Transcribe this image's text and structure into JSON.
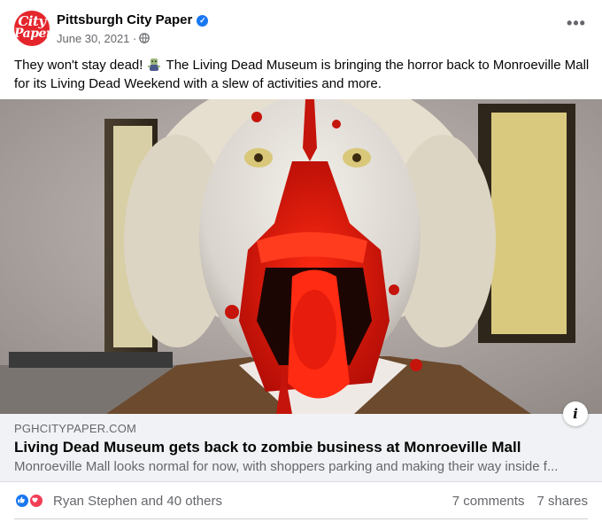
{
  "post": {
    "page_name": "Pittsburgh City Paper",
    "avatar_text_line1": "City",
    "avatar_text_line2": "Paper",
    "date": "June 30, 2021",
    "separator": "·",
    "more_label": "•••",
    "text_before_emoji": "They won't stay dead!",
    "text_after_emoji": "The Living Dead Museum is bringing the horror back to Monroeville Mall for its Living Dead Weekend with a slew of activities and more.",
    "icons": {
      "verified": "verified-badge-icon",
      "privacy": "globe-icon",
      "emoji": "zombie-emoji",
      "info": "info-icon",
      "like": "like-reaction-icon",
      "love": "love-reaction-icon"
    }
  },
  "link": {
    "domain": "PGHCITYPAPER.COM",
    "title": "Living Dead Museum gets back to zombie business at Monroeville Mall",
    "description": "Monroeville Mall looks normal for now, with shoppers parking and making their way inside f...",
    "info_label": "i"
  },
  "engagement": {
    "reaction_names": "Ryan Stephen and 40 others",
    "comments": "7 comments",
    "shares": "7 shares"
  },
  "colors": {
    "brand_red": "#e4262c",
    "facebook_blue": "#1877f2",
    "love_red": "#f33e58",
    "secondary_text": "#65676b"
  }
}
